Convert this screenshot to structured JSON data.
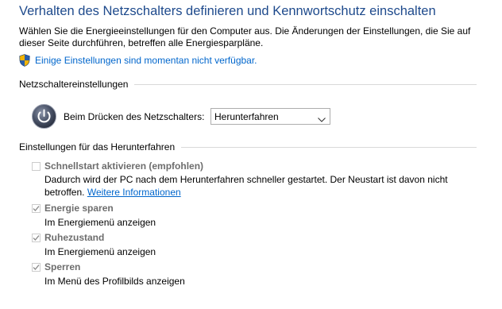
{
  "title": "Verhalten des Netzschalters definieren und Kennwortschutz einschalten",
  "intro": "Wählen Sie die Energieeinstellungen für den Computer aus. Die Änderungen der Einstellungen, die Sie auf dieser Seite durchführen, betreffen alle Energiesparpläne.",
  "unavailable_link": "Einige Einstellungen sind momentan nicht verfügbar.",
  "power_button_section": {
    "header": "Netzschaltereinstellungen",
    "label": "Beim Drücken des Netzschalters:",
    "selected_value": "Herunterfahren"
  },
  "shutdown_section": {
    "header": "Einstellungen für das Herunterfahren",
    "fast_startup": {
      "title": "Schnellstart aktivieren (empfohlen)",
      "checked": false,
      "description": "Dadurch wird der PC nach dem Herunterfahren schneller gestartet. Der Neustart ist davon nicht betroffen.",
      "more_info_link": "Weitere Informationen"
    },
    "options": [
      {
        "title": "Energie sparen",
        "checked": true,
        "description": "Im Energiemenü anzeigen"
      },
      {
        "title": "Ruhezustand",
        "checked": true,
        "description": "Im Energiemenü anzeigen"
      },
      {
        "title": "Sperren",
        "checked": true,
        "description": "Im Menü des Profilbilds anzeigen"
      }
    ]
  },
  "colors": {
    "title": "#1e4a8c",
    "link": "#0066cc",
    "disabled_text": "#6d6d6d",
    "checkbox_border": "#cccccc"
  }
}
